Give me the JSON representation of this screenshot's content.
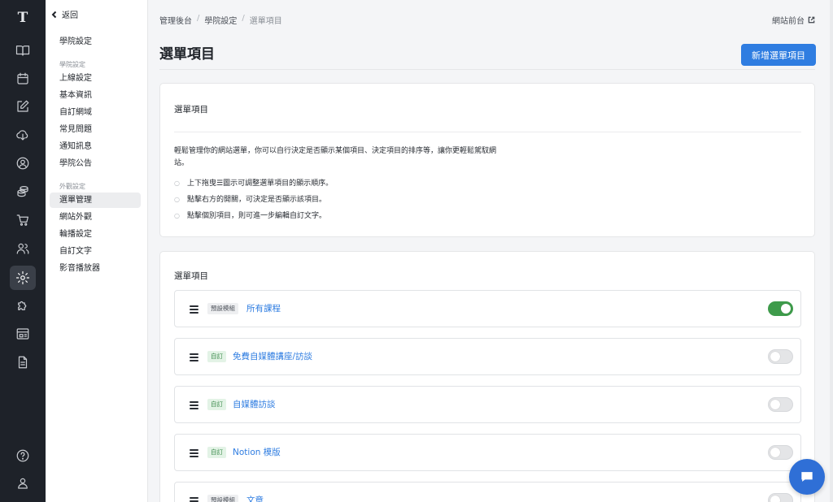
{
  "app": {
    "logo": "T"
  },
  "rail": {
    "icons": [
      "book-icon",
      "calendar-icon",
      "edit-icon",
      "cloud-download-icon",
      "user-circle-icon",
      "coins-icon",
      "cart-icon",
      "users-icon",
      "gear-icon",
      "puzzle-icon",
      "layout-icon",
      "document-icon",
      "help-icon",
      "account-icon"
    ],
    "active": "gear-icon"
  },
  "sidebar": {
    "back_label": "返回",
    "top_item": "學院設定",
    "group1_label": "學院設定",
    "group1": [
      "上線設定",
      "基本資訊",
      "自訂網域",
      "常見問題",
      "通知訊息",
      "學院公告"
    ],
    "group2_label": "外觀設定",
    "group2": [
      "選單管理",
      "網站外觀",
      "輪播設定",
      "自訂文字",
      "影音播放器"
    ],
    "active_item": "選單管理"
  },
  "breadcrumb": [
    "管理後台",
    "學院設定",
    "選單項目"
  ],
  "front_link": "網站前台",
  "page_title": "選單項目",
  "add_button": "新增選單項目",
  "info_card": {
    "title": "選單項目",
    "description": "輕鬆管理你的網站選單，你可以自行決定是否顯示某個項目、決定項目的排序等，讓你更輕鬆駕馭網站。",
    "bullets": [
      "上下拖曳☰圖示可調整選單項目的顯示順序。",
      "點擊右方的開關，可決定是否顯示該項目。",
      "點擊個別項目，則可進一步編輯自訂文字。"
    ]
  },
  "menu_card": {
    "title": "選單項目",
    "items": [
      {
        "badge": "預設模組",
        "badge_type": "default",
        "label": "所有課程",
        "enabled": true
      },
      {
        "badge": "自訂",
        "badge_type": "custom",
        "label": "免費自媒體講座/訪談",
        "enabled": false
      },
      {
        "badge": "自訂",
        "badge_type": "custom",
        "label": "自媒體訪談",
        "enabled": false
      },
      {
        "badge": "自訂",
        "badge_type": "custom",
        "label": "Notion 模版",
        "enabled": false
      },
      {
        "badge": "預設模組",
        "badge_type": "default",
        "label": "文章",
        "enabled": false
      }
    ]
  },
  "colors": {
    "primary": "#2f7de1",
    "toggle_on": "#3e9b4b",
    "rail_bg": "#1e2229"
  }
}
